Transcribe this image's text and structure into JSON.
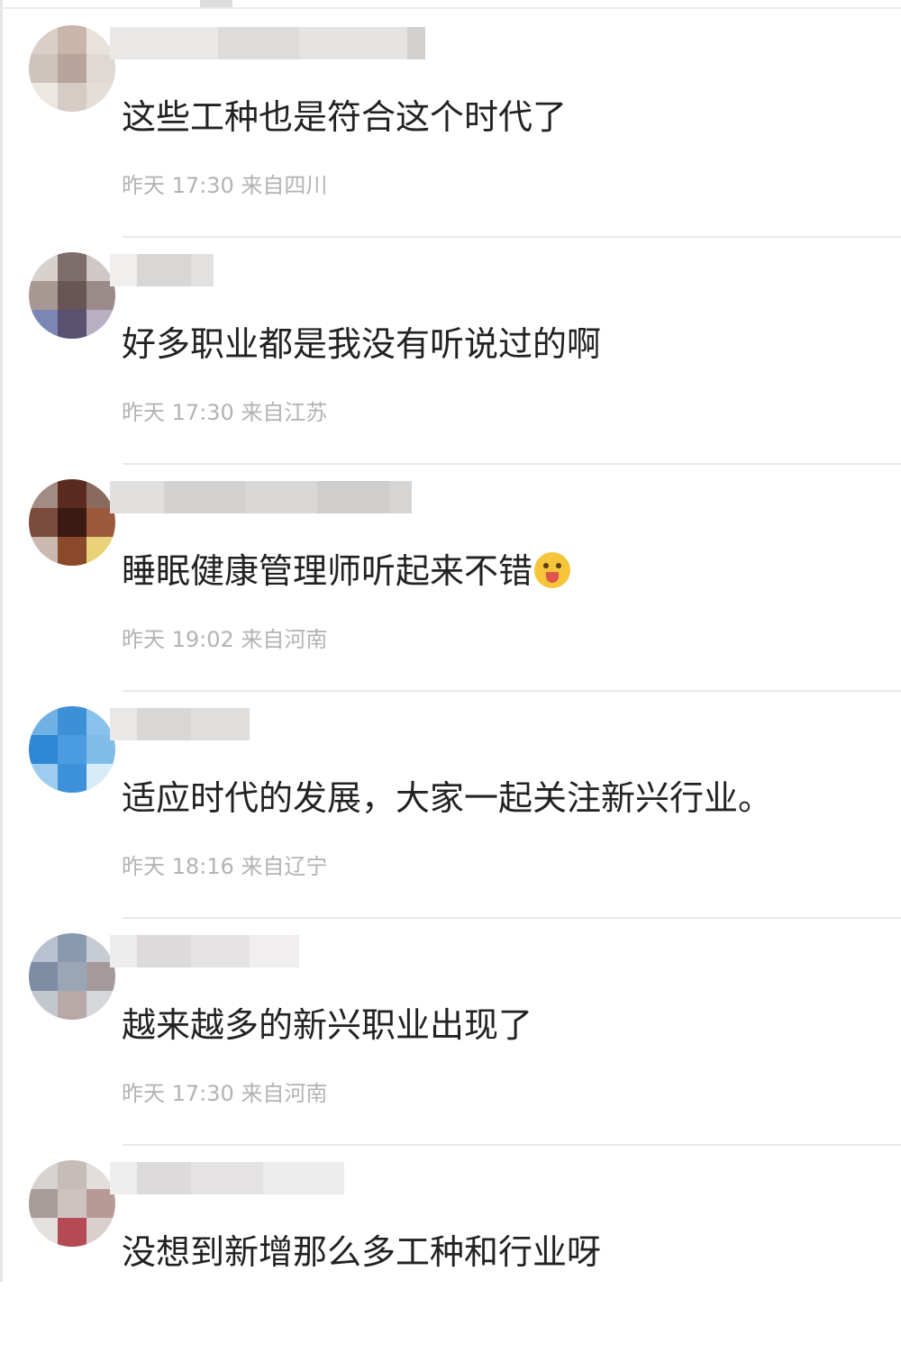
{
  "comments": [
    {
      "text": "这些工种也是符合这个时代了",
      "time": "昨天 17:30",
      "from": "来自四川",
      "avatar_colors": [
        "#d9cfc8",
        "#c9b5aa",
        "#e8e2dc",
        "#cfc3bd",
        "#b9a49c",
        "#e0d8d2",
        "#ece7e3",
        "#d6ccc6",
        "#e4ddd8"
      ]
    },
    {
      "text": "好多职业都是我没有听说过的啊",
      "time": "昨天 17:30",
      "from": "来自江苏",
      "avatar_colors": [
        "#d8d2cf",
        "#7d6d6b",
        "#cfc8c6",
        "#a89894",
        "#6a5556",
        "#9a8a89",
        "#7b86b4",
        "#5a5170",
        "#b8b0c2"
      ]
    },
    {
      "text": "睡眠健康管理师听起来不错",
      "emoji": "tongue-out-emoji",
      "time": "昨天 19:02",
      "from": "来自河南",
      "avatar_colors": [
        "#a28b82",
        "#5a2a1f",
        "#8a6a5e",
        "#7a4a3c",
        "#3a1a12",
        "#9c5a3c",
        "#cbb9b0",
        "#8a4a2a",
        "#e8d27a"
      ]
    },
    {
      "text": "适应时代的发展，大家一起关注新兴行业。",
      "time": "昨天 18:16",
      "from": "来自辽宁",
      "avatar_colors": [
        "#6fb1e3",
        "#3d8fd6",
        "#89c2ec",
        "#2f86d6",
        "#4a9be0",
        "#7fbce8",
        "#9cccef",
        "#3d91da",
        "#d8ebf8"
      ]
    },
    {
      "text": "越来越多的新兴职业出现了",
      "time": "昨天 17:30",
      "from": "来自河南",
      "avatar_colors": [
        "#b8c1cf",
        "#8a9aae",
        "#c7ccd4",
        "#7e8da3",
        "#9aa6b6",
        "#a49a9c",
        "#c2c6cd",
        "#b9a8a8",
        "#d5d7db"
      ]
    },
    {
      "text": "没想到新增那么多工种和行业呀",
      "time": "",
      "from": "",
      "avatar_colors": [
        "#d7d3d0",
        "#c6bcb8",
        "#e2dedb",
        "#a89c98",
        "#cfc3c0",
        "#b79a96",
        "#e4e0dd",
        "#b44a52",
        "#d9cfcc"
      ]
    }
  ]
}
